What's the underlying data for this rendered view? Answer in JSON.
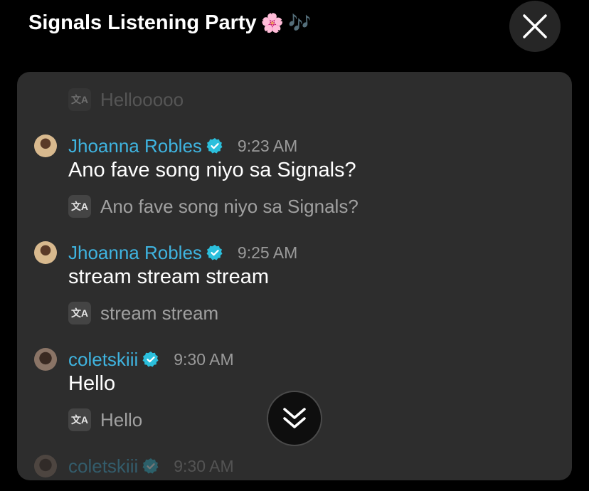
{
  "header": {
    "title": "Signals Listening Party",
    "emoji": [
      "🌸",
      "🎶"
    ],
    "close_icon": "close-x-icon"
  },
  "messages": [
    {
      "id": "prev",
      "translation": "Hellooooo"
    },
    {
      "id": "m1",
      "username": "Jhoanna Robles",
      "verified": true,
      "time": "9:23 AM",
      "text": "Ano fave song niyo sa Signals?",
      "translation": "Ano fave song niyo sa Signals?"
    },
    {
      "id": "m2",
      "username": "Jhoanna Robles",
      "verified": true,
      "time": "9:25 AM",
      "text": "stream stream stream",
      "translation": "stream stream"
    },
    {
      "id": "m3",
      "username": "coletskiii",
      "verified": true,
      "time": "9:30 AM",
      "text": "Hello",
      "translation": "Hello"
    },
    {
      "id": "m4",
      "username": "coletskiii",
      "verified": true,
      "time": "9:30 AM"
    }
  ],
  "icons": {
    "translate": "translate-icon",
    "verified": "verified-badge-icon",
    "scroll": "double-chevron-down-icon"
  },
  "translate_glyph": "文A",
  "colors": {
    "username": "#3fb4e0",
    "verified": "#2bbfdc",
    "panel": "#2d2d2d",
    "background": "#000000"
  }
}
